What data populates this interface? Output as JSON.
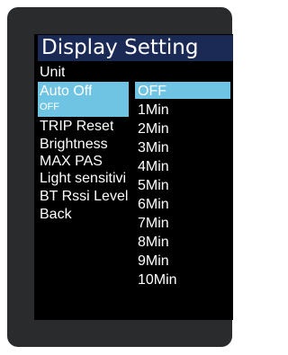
{
  "screen": {
    "title": "Display Setting",
    "menu": [
      {
        "label": "Unit"
      },
      {
        "label": "Auto Off",
        "value": "OFF",
        "selected": true
      },
      {
        "label": "TRIP Reset"
      },
      {
        "label": "Brightness"
      },
      {
        "label": "MAX PAS"
      },
      {
        "label": "Light sensitivi"
      },
      {
        "label": "BT Rssi Level"
      },
      {
        "label": "Back"
      }
    ],
    "options": [
      "OFF",
      "1Min",
      "2Min",
      "3Min",
      "4Min",
      "5Min",
      "6Min",
      "7Min",
      "8Min",
      "9Min",
      "10Min"
    ],
    "selected_option": "OFF"
  },
  "colors": {
    "title_bar": "#1a2a55",
    "highlight": "#6fc3e3",
    "screen_bg": "#000000",
    "bezel": "#2a2b2c",
    "text": "#ffffff"
  }
}
